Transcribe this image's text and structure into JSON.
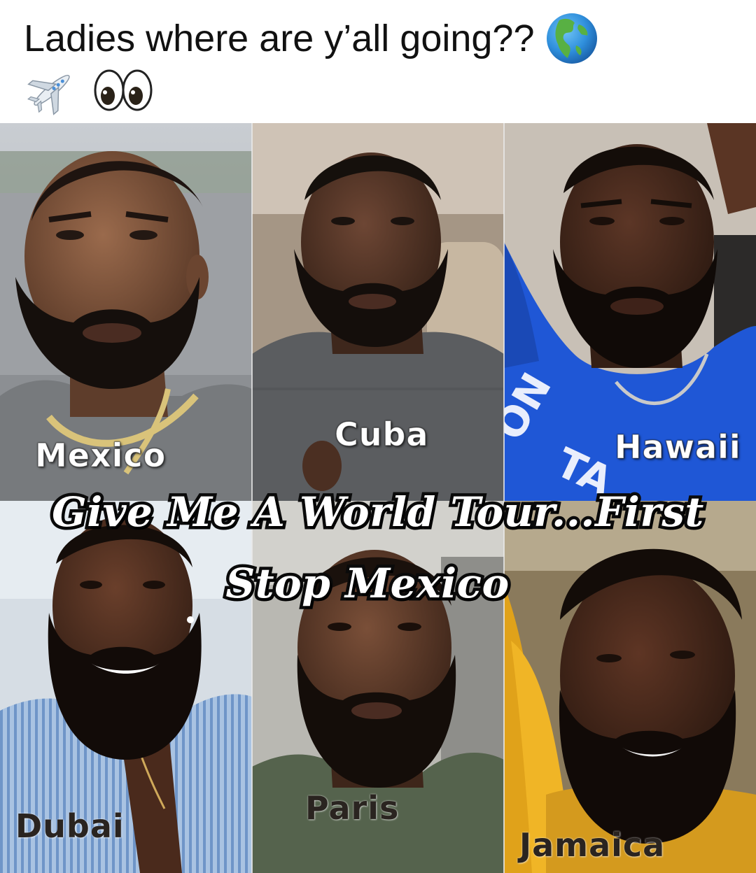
{
  "caption": {
    "text": "Ladies where are y’all going??",
    "emojis": [
      "globe-emoji",
      "airplane-emoji",
      "eyes-emoji"
    ]
  },
  "overlay": {
    "line1": "Give Me A World Tour...First",
    "line2": "Stop Mexico"
  },
  "tiles": [
    {
      "label": "Mexico"
    },
    {
      "label": "Cuba"
    },
    {
      "label": "Hawaii"
    },
    {
      "label": "Dubai"
    },
    {
      "label": "Paris"
    },
    {
      "label": "Jamaica"
    }
  ],
  "colors": {
    "overlay_fill": "#ffffff",
    "overlay_stroke": "#0a0a0a",
    "hawaii_shirt": "#1f57d6",
    "jamaica_hood": "#e0a21a",
    "dubai_shirt": "#8fb2d9"
  }
}
